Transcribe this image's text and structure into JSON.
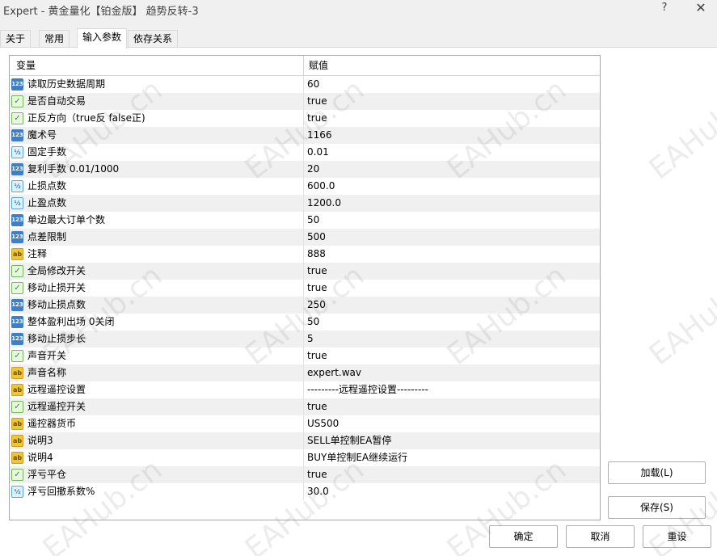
{
  "window": {
    "title": "Expert - 黄金量化【铂金版】 趋势反转-3",
    "help_label": "?",
    "close_label": "✕"
  },
  "tabs": [
    {
      "label": "关于"
    },
    {
      "label": "常用"
    },
    {
      "label": "输入参数"
    },
    {
      "label": "依存关系"
    }
  ],
  "grid": {
    "header_variable": "变量",
    "header_value": "赋值",
    "rows": [
      {
        "type": "int",
        "icon": "123",
        "name": "读取历史数据周期",
        "value": "60"
      },
      {
        "type": "bool",
        "icon": "✓",
        "name": "是否自动交易",
        "value": "true"
      },
      {
        "type": "bool",
        "icon": "✓",
        "name": "正反方向（true反 false正)",
        "value": "true"
      },
      {
        "type": "int",
        "icon": "123",
        "name": "魔术号",
        "value": "1166"
      },
      {
        "type": "double",
        "icon": "½",
        "name": "固定手数",
        "value": "0.01"
      },
      {
        "type": "int",
        "icon": "123",
        "name": "复利手数 0.01/1000",
        "value": "20"
      },
      {
        "type": "double",
        "icon": "½",
        "name": "止损点数",
        "value": "600.0"
      },
      {
        "type": "double",
        "icon": "½",
        "name": "止盈点数",
        "value": "1200.0"
      },
      {
        "type": "int",
        "icon": "123",
        "name": "单边最大订单个数",
        "value": "50"
      },
      {
        "type": "int",
        "icon": "123",
        "name": "点差限制",
        "value": "500"
      },
      {
        "type": "string",
        "icon": "ab",
        "name": "注释",
        "value": "888"
      },
      {
        "type": "bool",
        "icon": "✓",
        "name": "全局修改开关",
        "value": "true"
      },
      {
        "type": "bool",
        "icon": "✓",
        "name": "移动止损开关",
        "value": "true"
      },
      {
        "type": "int",
        "icon": "123",
        "name": "移动止损点数",
        "value": "250"
      },
      {
        "type": "int",
        "icon": "123",
        "name": "整体盈利出场 0关闭",
        "value": "50"
      },
      {
        "type": "int",
        "icon": "123",
        "name": "移动止损步长",
        "value": "5"
      },
      {
        "type": "bool",
        "icon": "✓",
        "name": "声音开关",
        "value": "true"
      },
      {
        "type": "string",
        "icon": "ab",
        "name": "声音名称",
        "value": "expert.wav"
      },
      {
        "type": "string",
        "icon": "ab",
        "name": "远程遥控设置",
        "value": "---------远程遥控设置---------"
      },
      {
        "type": "bool",
        "icon": "✓",
        "name": "远程遥控开关",
        "value": "true"
      },
      {
        "type": "string",
        "icon": "ab",
        "name": "遥控器货币",
        "value": "US500"
      },
      {
        "type": "string",
        "icon": "ab",
        "name": "说明3",
        "value": "SELL单控制EA暂停"
      },
      {
        "type": "string",
        "icon": "ab",
        "name": "说明4",
        "value": "BUY单控制EA继续运行"
      },
      {
        "type": "bool",
        "icon": "✓",
        "name": "浮亏平仓",
        "value": "true"
      },
      {
        "type": "double",
        "icon": "½",
        "name": "浮亏回撤系数%",
        "value": "30.0"
      }
    ]
  },
  "buttons": {
    "load": "加载(L)",
    "save": "保存(S)",
    "ok": "确定",
    "cancel": "取消",
    "reset": "重设"
  },
  "watermark": "EAHub.cn"
}
